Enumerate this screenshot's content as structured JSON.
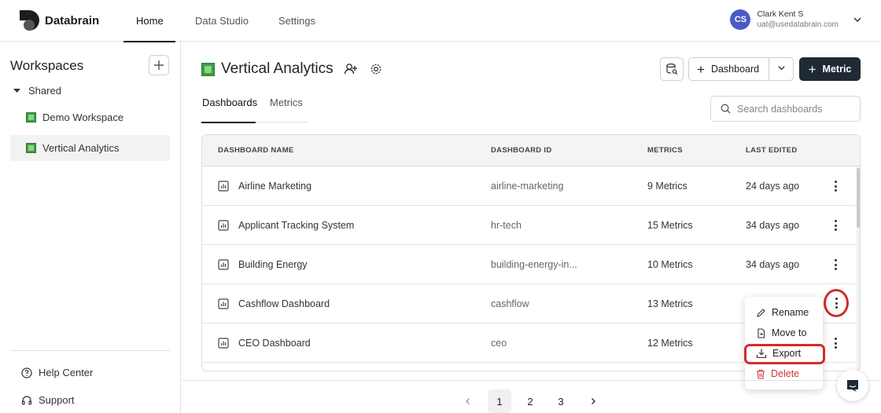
{
  "app": {
    "brand": "Databrain"
  },
  "nav": {
    "tabs": [
      "Home",
      "Data Studio",
      "Settings"
    ]
  },
  "user": {
    "initials": "CS",
    "name": "Clark Kent S",
    "email": "uat@usedatabrain.com",
    "avatar_color": "#4a5ac9"
  },
  "sidebar": {
    "title": "Workspaces",
    "group": "Shared",
    "items": [
      {
        "label": "Demo Workspace",
        "active": false
      },
      {
        "label": "Vertical Analytics",
        "active": true
      }
    ],
    "footer": {
      "help": "Help Center",
      "support": "Support"
    }
  },
  "main": {
    "title": "Vertical Analytics",
    "buttons": {
      "dashboard": "Dashboard",
      "metric": "Metric"
    },
    "tabs": [
      "Dashboards",
      "Metrics"
    ],
    "search": {
      "placeholder": "Search dashboards",
      "value": ""
    },
    "table": {
      "columns": [
        "DASHBOARD NAME",
        "DASHBOARD ID",
        "METRICS",
        "LAST EDITED"
      ],
      "rows": [
        {
          "name": "Airline Marketing",
          "id": "airline-marketing",
          "metrics": "9 Metrics",
          "edited": "24 days ago"
        },
        {
          "name": "Applicant Tracking System",
          "id": "hr-tech",
          "metrics": "15 Metrics",
          "edited": "34 days ago"
        },
        {
          "name": "Building Energy",
          "id": "building-energy-in...",
          "metrics": "10 Metrics",
          "edited": "34 days ago"
        },
        {
          "name": "Cashflow Dashboard",
          "id": "cashflow",
          "metrics": "13 Metrics",
          "edited": ""
        },
        {
          "name": "CEO Dashboard",
          "id": "ceo",
          "metrics": "12 Metrics",
          "edited": ""
        }
      ]
    },
    "context_menu": {
      "rename": "Rename",
      "move": "Move to",
      "export": "Export",
      "delete": "Delete"
    },
    "pagination": {
      "pages": [
        "1",
        "2",
        "3"
      ],
      "current": "1"
    }
  },
  "colors": {
    "accent_dark": "#1f2a35",
    "highlight": "#d22c2c",
    "danger": "#d0343b",
    "workspace_green": "#3c9d3f"
  }
}
